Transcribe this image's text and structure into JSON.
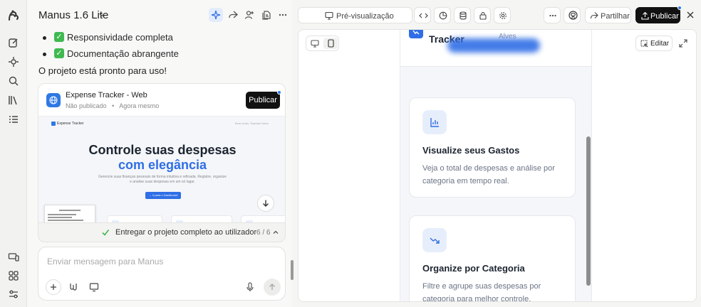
{
  "chat": {
    "model_name": "Manus 1.6 Lite",
    "bullets": [
      {
        "label": "Responsividade completa"
      },
      {
        "label": "Documentação abrangente"
      }
    ],
    "done_message": "O projeto está pronto para uso!",
    "project_card": {
      "title": "Expense Tracker - Web",
      "status": "Não publicado",
      "time": "Agora mesmo",
      "publish_label": "Publicar",
      "thumbnail": {
        "logo_text": "Expense Tracker",
        "nav_right": "Bem-vindo, Raphael Alves",
        "headline": "Controle suas despesas",
        "headline_accent": "com elegância",
        "subtitle": "Gerencie suas finanças pessoais de forma intuitiva e refinada. Registre, organize e analise suas despesas em um só lugar.",
        "cta": "→ Ir para o Dashboard"
      }
    },
    "task": {
      "label": "Entregar o projeto completo ao utilizador",
      "progress": "6 / 6"
    },
    "composer": {
      "placeholder": "Enviar mensagem para Manus"
    }
  },
  "preview": {
    "preview_label": "Pré-visualização",
    "share_label": "Partilhar",
    "publish_label": "Publicar",
    "edit_label": "Editar",
    "app": {
      "title": "Tracker",
      "user": "Alves",
      "features": [
        {
          "title": "Visualize seus Gastos",
          "description": "Veja o total de despesas e análise por categoria em tempo real."
        },
        {
          "title": "Organize por Categoria",
          "description": "Filtre e agrupe suas despesas por categoria para melhor controle."
        }
      ]
    }
  },
  "colors": {
    "accent": "#2f6ee6",
    "success": "#3fb950",
    "dark": "#111111"
  }
}
